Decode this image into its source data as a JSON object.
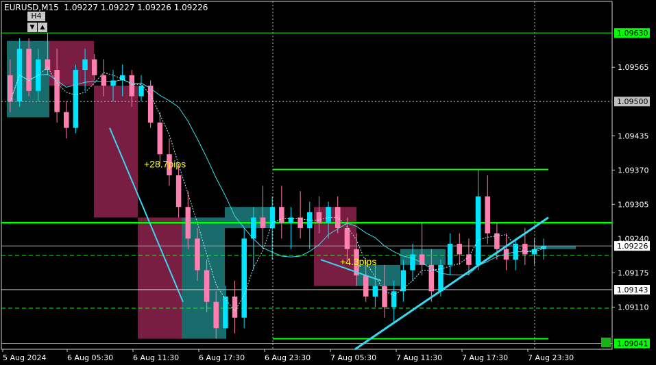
{
  "header": {
    "symbol_line": "EURUSD,M15  1.09227 1.09227 1.09226 1.09226",
    "timeframe_button": "H4",
    "down_arrow": "▼",
    "up_arrow": "▲",
    "menu_arrow": "▼"
  },
  "colors": {
    "background": "#000000",
    "bull_candle": "#00e5ff",
    "bear_candle": "#ff80b0",
    "bull_box": "#1a6b6b",
    "bear_box": "#7a1d42",
    "level_line": "#00ff00",
    "ma_line": "#39e0e8",
    "trend_line": "#38d9f0"
  },
  "chart_data": {
    "type": "candlestick",
    "symbol": "EURUSD",
    "timeframe": "M15",
    "ylim": [
      1.0903,
      1.0969
    ],
    "y_ticks": [
      "1.09565",
      "1.09435",
      "1.09370",
      "1.09305",
      "1.09175",
      "1.09110"
    ],
    "x_ticks": [
      "5 Aug 2024",
      "6 Aug 05:30",
      "6 Aug 11:30",
      "6 Aug 17:30",
      "6 Aug 23:30",
      "7 Aug 05:30",
      "7 Aug 11:30",
      "7 Aug 17:30",
      "7 Aug 23:30"
    ],
    "price_labels": [
      {
        "label": "1.09630",
        "value": 1.0963,
        "style": "green-box"
      },
      {
        "label": "1.09500",
        "value": 1.095,
        "style": "gray-box"
      },
      {
        "label": "1.09240",
        "value": 1.0924,
        "style": "text"
      },
      {
        "label": "1.09226",
        "value": 1.09226,
        "style": "white-box"
      },
      {
        "label": "1.09143",
        "value": 1.09143,
        "style": "white-box"
      },
      {
        "label": "1.09041",
        "value": 1.09041,
        "style": "green-box"
      }
    ],
    "annotations": [
      {
        "text": "+28.7pips",
        "color": "#ffff00"
      },
      {
        "text": "+4.3pips",
        "color": "#ffff00"
      }
    ],
    "ohlc": [
      [
        1.0955,
        1.0958,
        1.0948,
        1.095
      ],
      [
        1.095,
        1.0962,
        1.0949,
        1.096
      ],
      [
        1.096,
        1.0962,
        1.0951,
        1.0952
      ],
      [
        1.0952,
        1.096,
        1.095,
        1.0958
      ],
      [
        1.0958,
        1.0963,
        1.0955,
        1.0956
      ],
      [
        1.0956,
        1.096,
        1.0946,
        1.0948
      ],
      [
        1.0948,
        1.095,
        1.0943,
        1.0945
      ],
      [
        1.0945,
        1.0957,
        1.0944,
        1.0956
      ],
      [
        1.0956,
        1.096,
        1.0952,
        1.0958
      ],
      [
        1.0958,
        1.0959,
        1.0954,
        1.0955
      ],
      [
        1.0955,
        1.0958,
        1.0951,
        1.0953
      ],
      [
        1.0953,
        1.0956,
        1.095,
        1.0954
      ],
      [
        1.0954,
        1.0957,
        1.0951,
        1.0955
      ],
      [
        1.0955,
        1.0956,
        1.0949,
        1.0951
      ],
      [
        1.0951,
        1.0955,
        1.095,
        1.0953
      ],
      [
        1.0953,
        1.0954,
        1.0945,
        1.0946
      ],
      [
        1.0946,
        1.0948,
        1.0938,
        1.094
      ],
      [
        1.094,
        1.0943,
        1.0934,
        1.0936
      ],
      [
        1.0936,
        1.0938,
        1.0928,
        1.093
      ],
      [
        1.093,
        1.0933,
        1.0922,
        1.0924
      ],
      [
        1.0924,
        1.0926,
        1.0916,
        1.0918
      ],
      [
        1.0918,
        1.092,
        1.091,
        1.0912
      ],
      [
        1.0912,
        1.0914,
        1.0905,
        1.0907
      ],
      [
        1.0907,
        1.0915,
        1.0905,
        1.0913
      ],
      [
        1.0913,
        1.0916,
        1.0906,
        1.0909
      ],
      [
        1.0909,
        1.0926,
        1.0907,
        1.0924
      ],
      [
        1.0924,
        1.093,
        1.0918,
        1.0928
      ],
      [
        1.0928,
        1.0934,
        1.0922,
        1.0926
      ],
      [
        1.0926,
        1.0932,
        1.092,
        1.093
      ],
      [
        1.093,
        1.0934,
        1.0924,
        1.0927
      ],
      [
        1.0927,
        1.093,
        1.0922,
        1.0928
      ],
      [
        1.0928,
        1.0933,
        1.0924,
        1.0926
      ],
      [
        1.0926,
        1.0931,
        1.0922,
        1.0929
      ],
      [
        1.0929,
        1.0932,
        1.0925,
        1.0927
      ],
      [
        1.0927,
        1.0931,
        1.0924,
        1.093
      ],
      [
        1.093,
        1.0932,
        1.0925,
        1.0926
      ],
      [
        1.0926,
        1.0928,
        1.092,
        1.0922
      ],
      [
        1.0922,
        1.0925,
        1.0915,
        1.0917
      ],
      [
        1.0917,
        1.092,
        1.0912,
        1.0913
      ],
      [
        1.0913,
        1.0919,
        1.0911,
        1.0915
      ],
      [
        1.0915,
        1.0919,
        1.0909,
        1.0911
      ],
      [
        1.0911,
        1.0916,
        1.0908,
        1.0914
      ],
      [
        1.0914,
        1.092,
        1.0912,
        1.0918
      ],
      [
        1.0918,
        1.0923,
        1.0916,
        1.0921
      ],
      [
        1.0921,
        1.0927,
        1.0917,
        1.0919
      ],
      [
        1.0919,
        1.0922,
        1.0912,
        1.0914
      ],
      [
        1.0914,
        1.092,
        1.0913,
        1.0919
      ],
      [
        1.0919,
        1.0925,
        1.0917,
        1.0923
      ],
      [
        1.0923,
        1.0925,
        1.0919,
        1.0921
      ],
      [
        1.0921,
        1.0924,
        1.0917,
        1.0919
      ],
      [
        1.0919,
        1.0937,
        1.0918,
        1.0932
      ],
      [
        1.0932,
        1.0936,
        1.0923,
        1.0925
      ],
      [
        1.0925,
        1.0927,
        1.092,
        1.0922
      ],
      [
        1.0922,
        1.0925,
        1.0918,
        1.092
      ],
      [
        1.092,
        1.0924,
        1.0918,
        1.0923
      ],
      [
        1.0923,
        1.0926,
        1.0919,
        1.0921
      ],
      [
        1.0921,
        1.0924,
        1.0919,
        1.0922
      ],
      [
        1.0922,
        1.0924,
        1.092,
        1.09226
      ]
    ]
  }
}
